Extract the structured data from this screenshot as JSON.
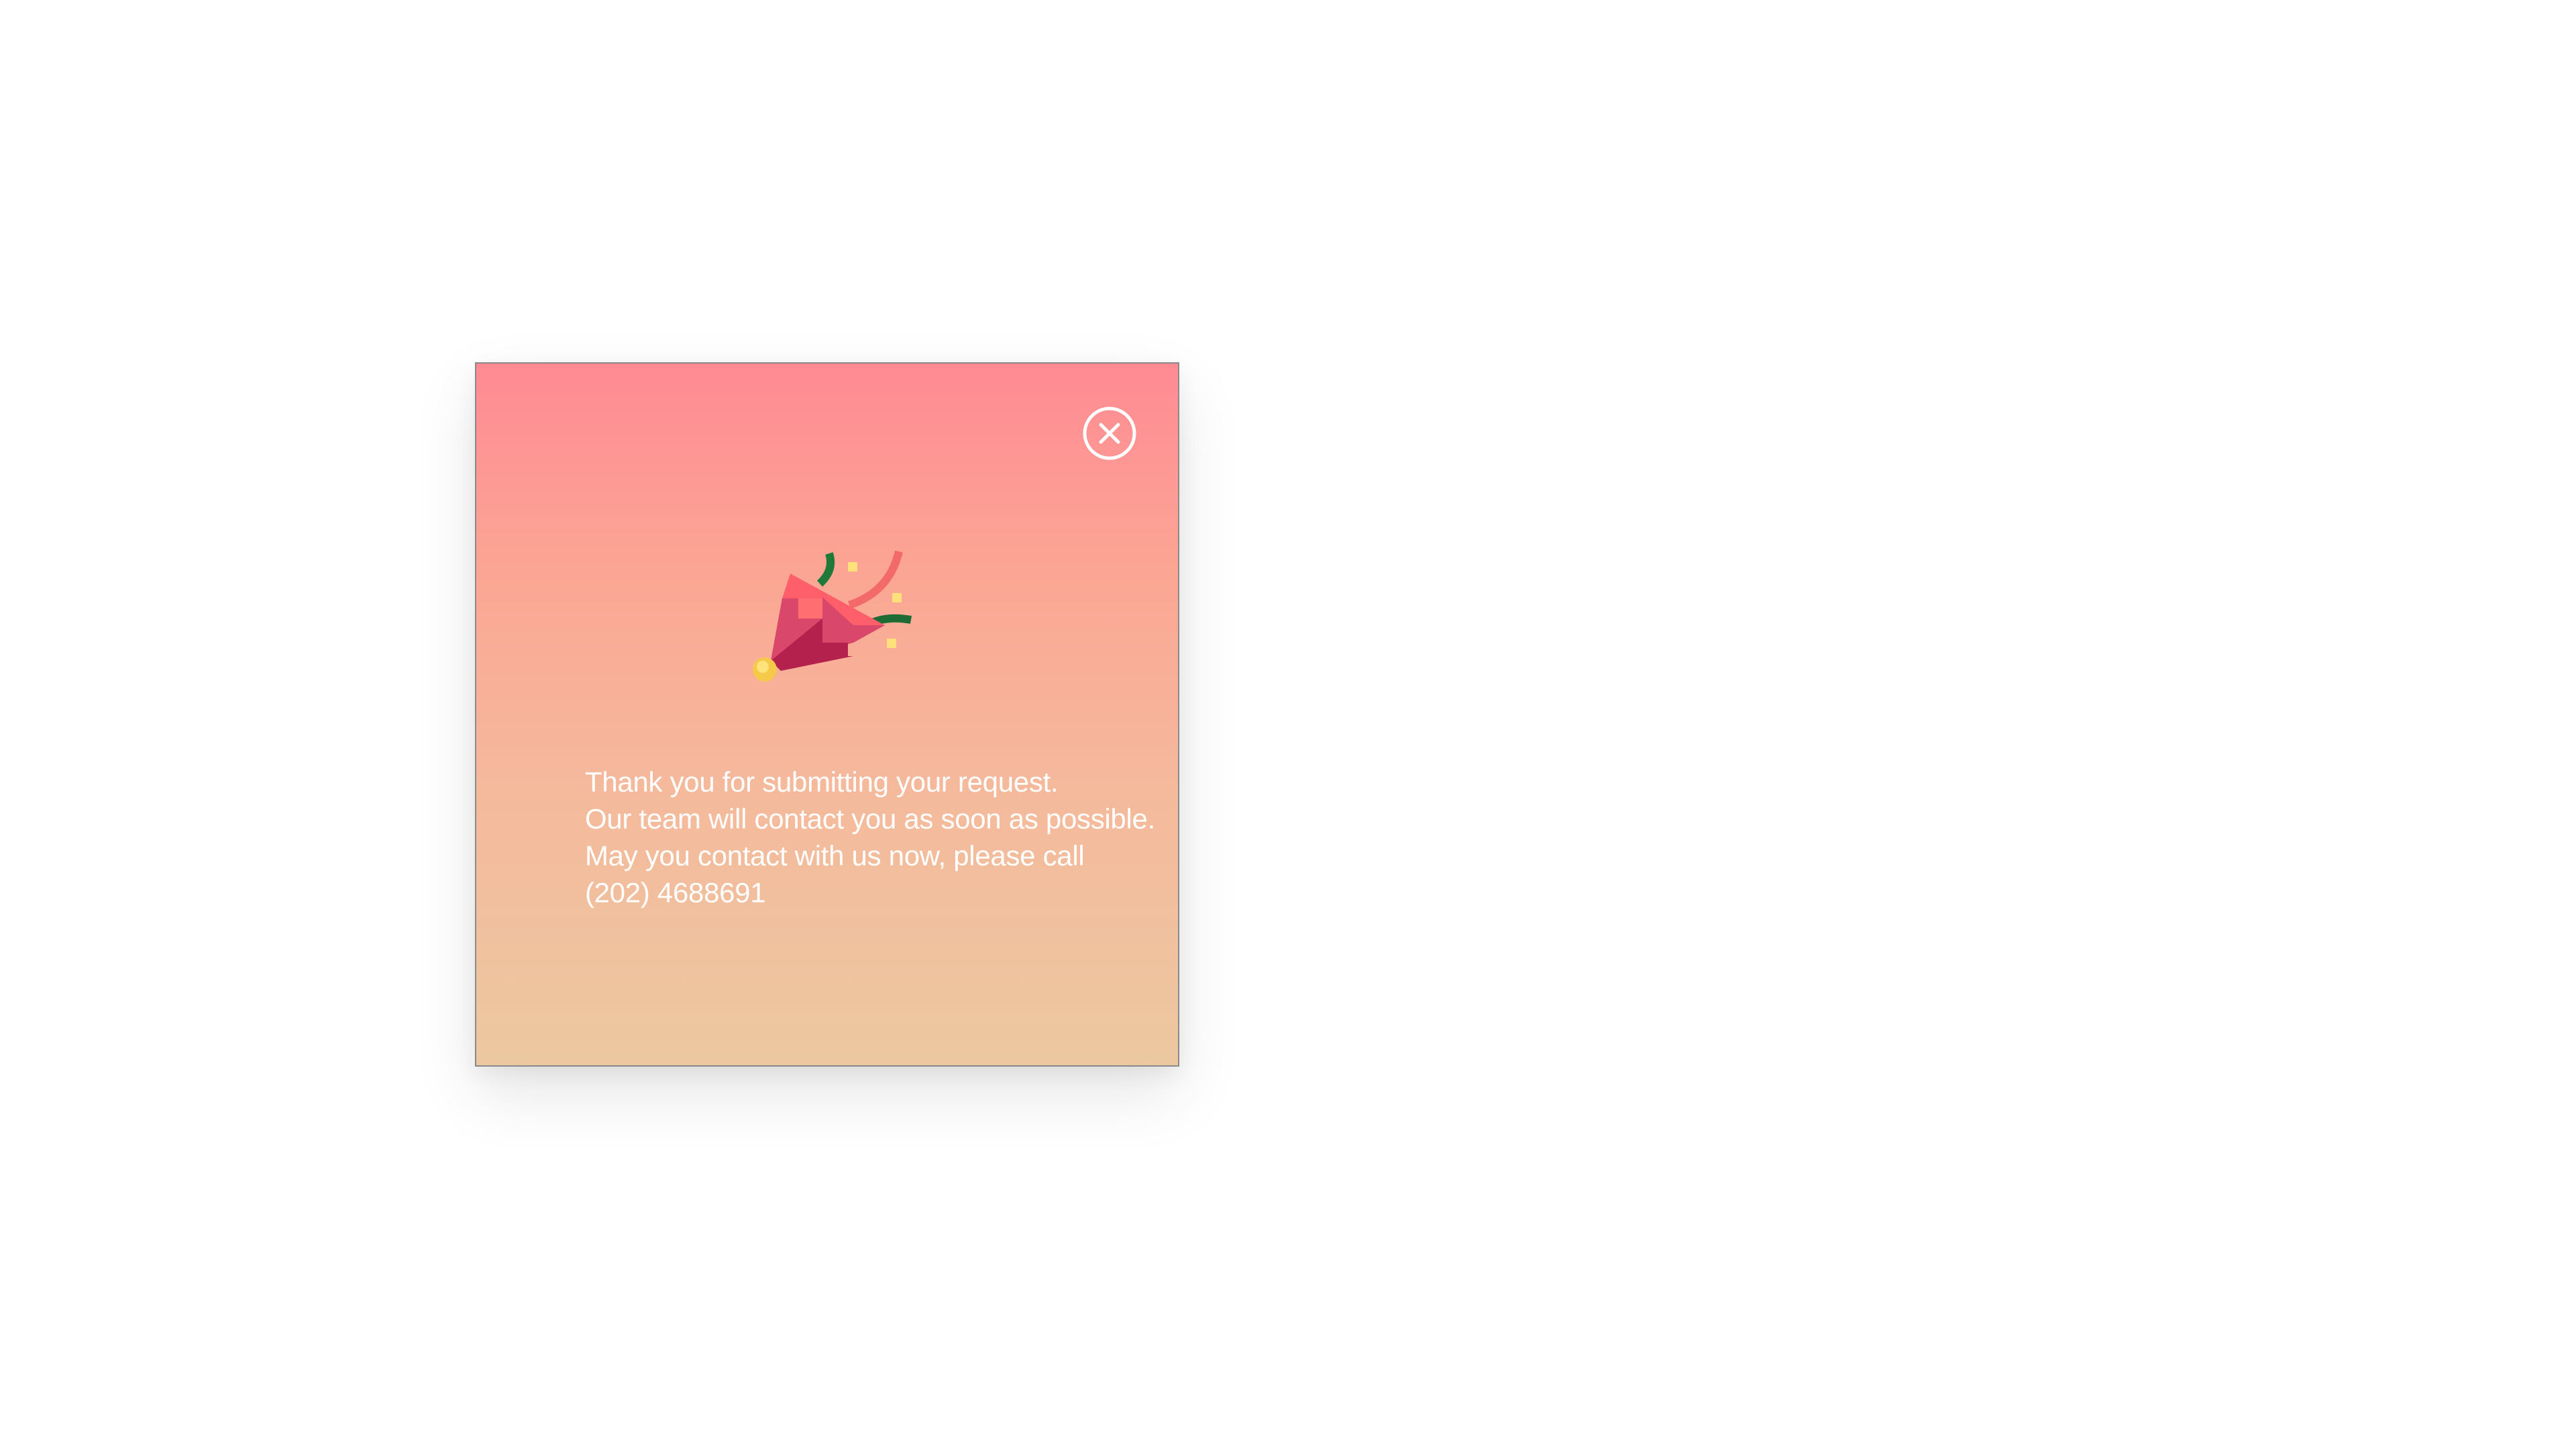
{
  "modal": {
    "close_icon": "close-circle-icon",
    "illustration_icon": "party-popper-icon",
    "message_lines": [
      "Thank you for submitting your request.",
      "Our team will contact you as soon as possible.",
      "May you contact with us now, please call",
      "(202) 4688691"
    ]
  },
  "colors": {
    "gradient_top": "#ff8a93",
    "gradient_bottom": "#ecc8a0",
    "text": "#ffffff",
    "border": "#8a8a8a"
  }
}
